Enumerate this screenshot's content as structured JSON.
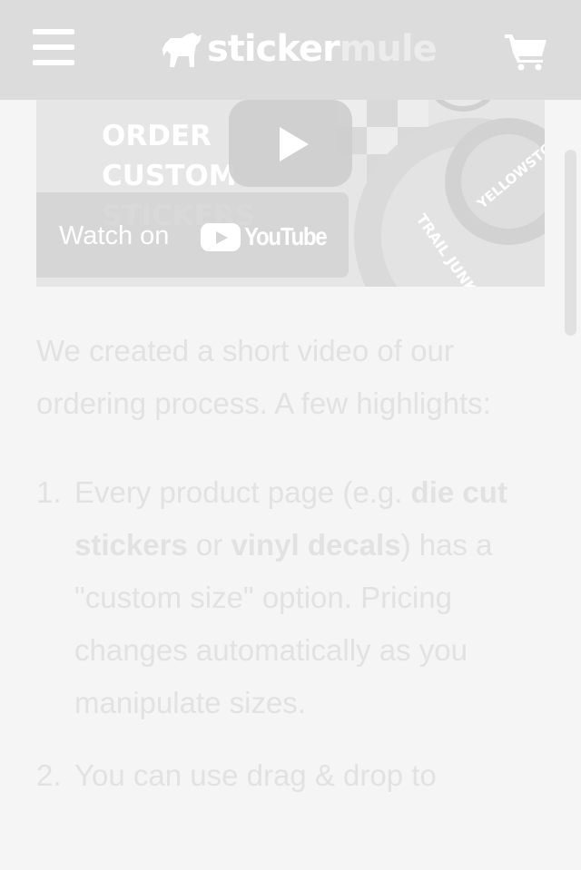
{
  "header": {
    "logo_primary": "sticker",
    "logo_secondary": "mule",
    "menu_icon": "hamburger-menu-icon",
    "cart_icon": "shopping-cart-icon"
  },
  "video": {
    "title": "ORDER\nCUSTOM\nSTICKERS",
    "watch_label": "Watch on",
    "platform": "YouTube",
    "play_icon": "play-icon"
  },
  "content": {
    "intro": "We created a short video of our ordering process. A few highlights:",
    "steps": [
      {
        "number": "1.",
        "text_a": "Every product page (e.g. ",
        "link_1": "die cut stickers",
        "text_b": " or ",
        "link_2": "vinyl decals",
        "text_c": ") has a \"custom size\" option. Pricing changes automatically as you manipulate sizes."
      },
      {
        "number": "2.",
        "text": "You can use drag & drop to"
      }
    ]
  },
  "colors": {
    "header_bg": "#dcdcdc",
    "page_bg": "#f5f5f5",
    "text": "#e2e2e2"
  }
}
